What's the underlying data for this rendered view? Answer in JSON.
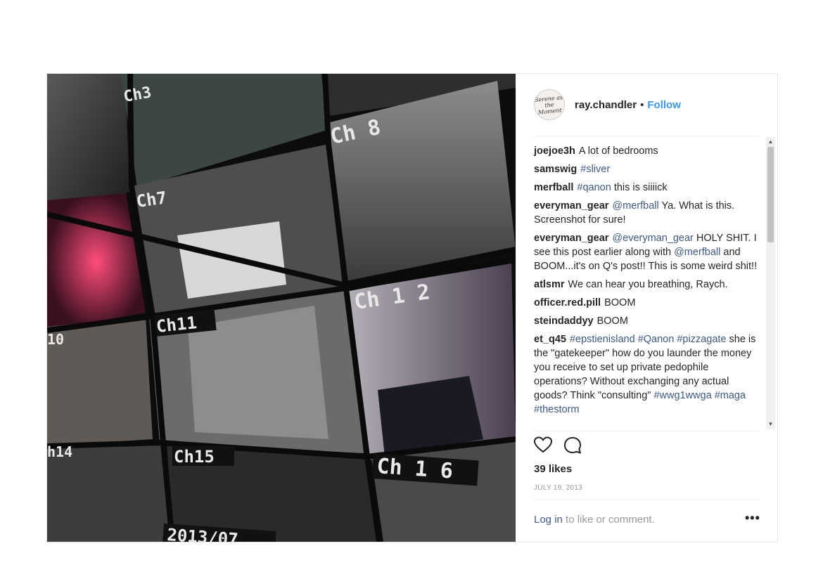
{
  "post": {
    "author": {
      "avatar_text": "Serene as the Moment",
      "username": "ray.chandler",
      "separator": "•",
      "follow_label": "Follow"
    },
    "photo": {
      "channel_labels": [
        "Ch3",
        "Ch 8",
        "Ch7",
        "Ch 1 2",
        "Ch11",
        "10",
        "h14",
        "Ch15",
        "Ch 1 6",
        "2013/07"
      ]
    },
    "comments": [
      {
        "user": "joejoe3h",
        "parts": [
          {
            "text": "A lot of bedrooms",
            "tag": false
          }
        ]
      },
      {
        "user": "samswig",
        "parts": [
          {
            "text": "#sliver",
            "tag": true
          }
        ]
      },
      {
        "user": "merfball",
        "parts": [
          {
            "text": "#qanon",
            "tag": true
          },
          {
            "text": " this is siiiick",
            "tag": false
          }
        ]
      },
      {
        "user": "everyman_gear",
        "parts": [
          {
            "text": "@merfball",
            "tag": true
          },
          {
            "text": " Ya. What is this. Screenshot for sure!",
            "tag": false
          }
        ]
      },
      {
        "user": "everyman_gear",
        "parts": [
          {
            "text": "@everyman_gear",
            "tag": true
          },
          {
            "text": " HOLY SHIT. I see this post earlier along with ",
            "tag": false
          },
          {
            "text": "@merfball",
            "tag": true
          },
          {
            "text": " and BOOM...it's on Q's post!! This is some weird shit!!",
            "tag": false
          }
        ]
      },
      {
        "user": "atlsmr",
        "parts": [
          {
            "text": "We can hear you breathing, Raych.",
            "tag": false
          }
        ]
      },
      {
        "user": "officer.red.pill",
        "parts": [
          {
            "text": "BOOM",
            "tag": false
          }
        ]
      },
      {
        "user": "steindaddyy",
        "parts": [
          {
            "text": "BOOM",
            "tag": false
          }
        ]
      },
      {
        "user": "et_q45",
        "parts": [
          {
            "text": "#epstienisland",
            "tag": true
          },
          {
            "text": " ",
            "tag": false
          },
          {
            "text": "#Qanon",
            "tag": true
          },
          {
            "text": " ",
            "tag": false
          },
          {
            "text": "#pizzagate",
            "tag": true
          },
          {
            "text": " she is the \"gatekeeper\" how do you launder the money you receive to set up private pedophile operations? Without exchanging any actual goods? Think \"consulting\" ",
            "tag": false
          },
          {
            "text": "#wwg1wwga",
            "tag": true
          },
          {
            "text": " ",
            "tag": false
          },
          {
            "text": "#maga",
            "tag": true
          },
          {
            "text": " ",
            "tag": false
          },
          {
            "text": "#thestorm",
            "tag": true
          }
        ]
      }
    ],
    "likes": "39 likes",
    "date": "JULY 19, 2013",
    "footer": {
      "login_label": "Log in",
      "rest": " to like or comment.",
      "more_label": "•••"
    },
    "icons": {
      "like": "heart-icon",
      "comment": "comment-bubble-icon",
      "scroll_up": "arrow-up-icon",
      "scroll_down": "arrow-down-icon"
    },
    "colors": {
      "link": "#3897f0",
      "tag": "#3c5a8a",
      "muted": "#999999"
    }
  }
}
